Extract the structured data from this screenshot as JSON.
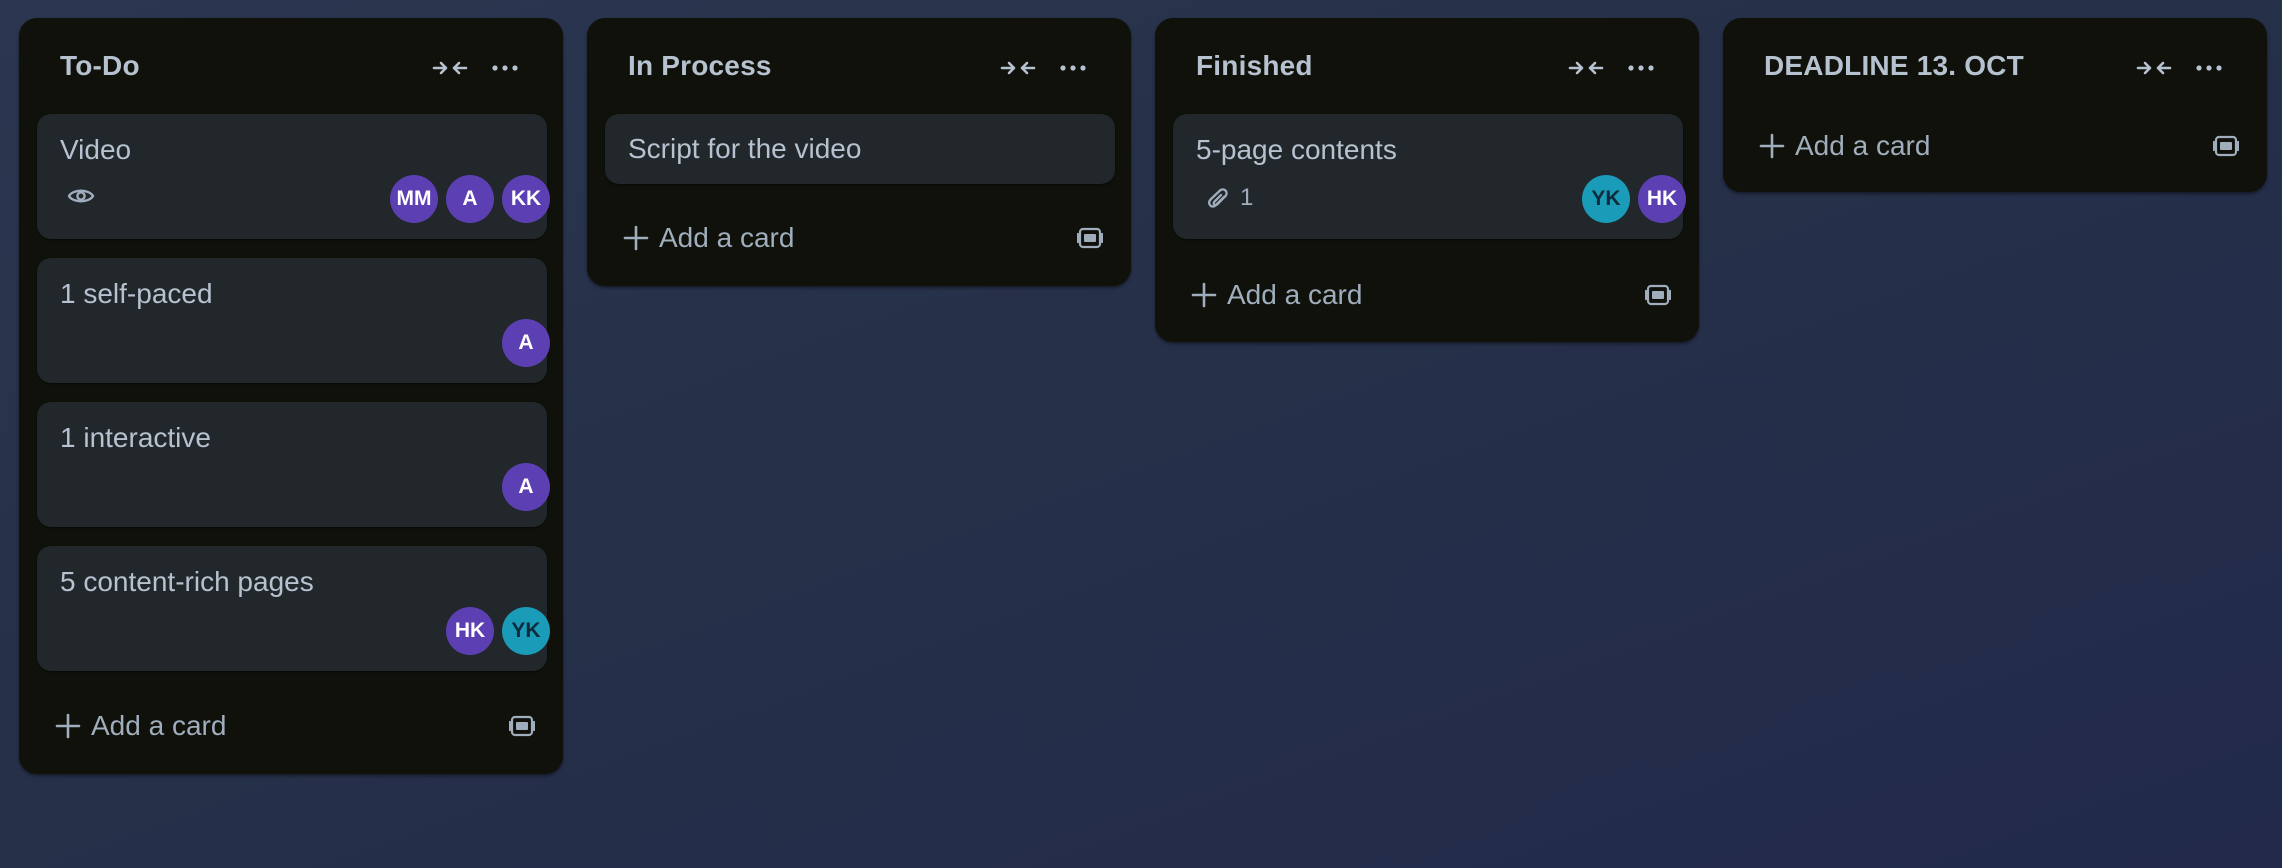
{
  "board": {
    "lists": [
      {
        "title": "To-Do",
        "cards": [
          {
            "title": "Video",
            "members": [
              "MM",
              "A",
              "KK"
            ],
            "watch_icon": "eye-icon"
          },
          {
            "title": "1 self-paced",
            "members": [
              "A"
            ]
          },
          {
            "title": "1 interactive",
            "members": [
              "A"
            ]
          },
          {
            "title": "5 content-rich pages",
            "members": [
              "HK",
              "YK"
            ]
          }
        ],
        "add_label": "Add a card"
      },
      {
        "title": "In Process",
        "cards": [
          {
            "title": "Script for the video"
          }
        ],
        "add_label": "Add a card"
      },
      {
        "title": "Finished",
        "cards": [
          {
            "title": "5-page contents",
            "attachments": "1",
            "members": [
              "YK",
              "HK"
            ]
          }
        ],
        "add_label": "Add a card"
      },
      {
        "title": "DEADLINE 13. OCT",
        "cards": [],
        "add_label": "Add a card"
      }
    ]
  },
  "icons": {
    "collapse": "collapse-arrows-icon",
    "more": "ellipsis-icon",
    "add": "plus-icon",
    "template": "card-template-icon",
    "watch": "eye-icon",
    "attachment": "paperclip-icon"
  },
  "colors": {
    "list_background": "#0f110a",
    "card_background": "#22272b",
    "avatar_purple": "#5d3fb4",
    "avatar_teal": "#1a9bb7",
    "text": "#b6c2cf"
  }
}
